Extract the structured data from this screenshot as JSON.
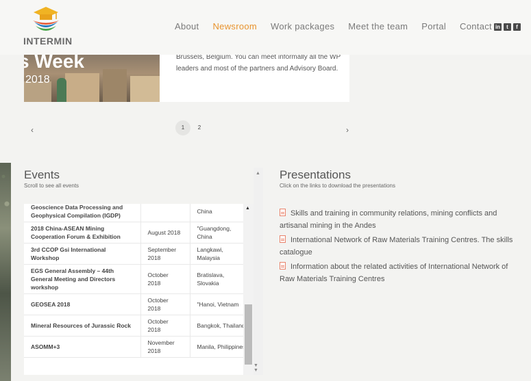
{
  "header": {
    "logo_text": "INTERMIN",
    "nav": [
      {
        "label": "About",
        "active": false
      },
      {
        "label": "Newsroom",
        "active": true
      },
      {
        "label": "Work packages",
        "active": false
      },
      {
        "label": "Meet the team",
        "active": false
      },
      {
        "label": "Portal",
        "active": false
      },
      {
        "label": "Contact",
        "active": false
      }
    ],
    "social": [
      "linkedin-icon",
      "twitter-icon",
      "facebook-icon"
    ]
  },
  "news": {
    "image_title": "s Week",
    "image_year": "2018",
    "text": "Brussels, Belgium. You can meet informally all the WP leaders and most of the partners and Advisory Board."
  },
  "pager": {
    "prev": "‹",
    "next": "›",
    "pages": [
      "1",
      "2"
    ],
    "current": "1"
  },
  "events": {
    "title": "Events",
    "subtitle": "Scroll to see all events",
    "rows": [
      {
        "name": "Geoscience Data Processing and Geophysical Compilation (IGDP)",
        "date": "",
        "place": "China"
      },
      {
        "name": "2018 China-ASEAN Mining Cooperation Forum & Exhibition",
        "date": "August 2018",
        "place": "\"Guangdong, China"
      },
      {
        "name": "3rd CCOP Gsi International Workshop",
        "date": "September 2018",
        "place": "Langkawi, Malaysia"
      },
      {
        "name": "EGS General Assembly – 44th General Meeting and Directors workshop",
        "date": "October 2018",
        "place": "Bratislava, Slovakia"
      },
      {
        "name": "GEOSEA 2018",
        "date": "October 2018",
        "place": "\"Hanoi, Vietnam"
      },
      {
        "name": "Mineral Resources of Jurassic Rock",
        "date": "October 2018",
        "place": "Bangkok, Thailand"
      },
      {
        "name": "ASOMM+3",
        "date": "November 2018",
        "place": "Manila, Philippines"
      }
    ]
  },
  "presentations": {
    "title": "Presentations",
    "subtitle": "Click on the links to download the presentations",
    "items": [
      "Skills and training in community relations, mining conflicts and artisanal mining in the Andes",
      "International Network of Raw Materials Training Centres. The skills catalogue",
      "Information about the related activities of International Network of Raw Materials Training Centres"
    ]
  }
}
